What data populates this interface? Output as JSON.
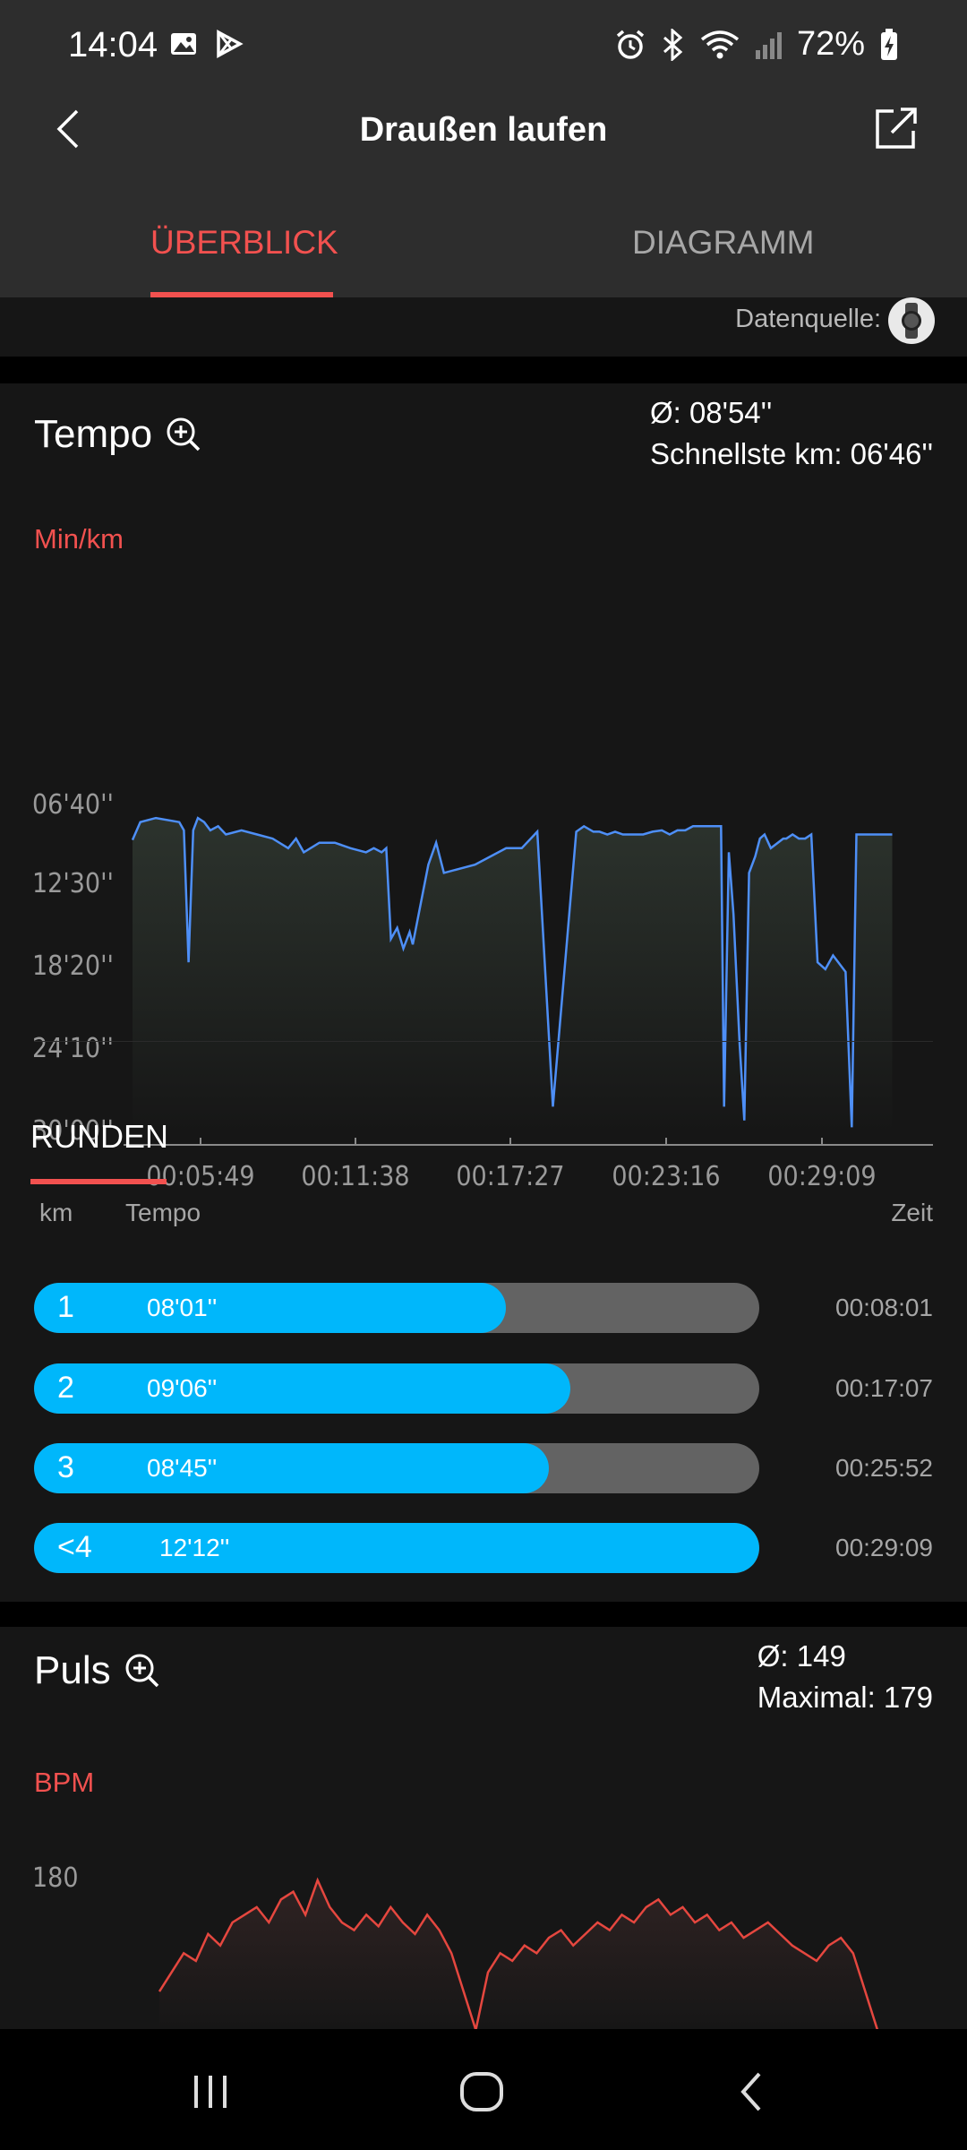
{
  "status_bar": {
    "time": "14:04",
    "battery": "72%",
    "icons": [
      "gallery-icon",
      "play-store-icon",
      "alarm-icon",
      "bluetooth-icon",
      "wifi-icon",
      "signal-icon",
      "battery-charging-icon"
    ]
  },
  "header": {
    "title": "Draußen laufen",
    "tabs": [
      {
        "label": "ÜBERBLICK",
        "active": true
      },
      {
        "label": "DIAGRAMM",
        "active": false
      }
    ]
  },
  "data_source": {
    "label": "Datenquelle:",
    "icon": "watch-icon"
  },
  "tempo": {
    "title": "Tempo",
    "avg": "Ø: 08'54''",
    "fastest": "Schnellste km: 06'46''",
    "unit": "Min/km",
    "chart_data": {
      "type": "line",
      "y_ticks": [
        "06'40''",
        "12'30''",
        "18'20''",
        "24'10''",
        "30'00''"
      ],
      "x_ticks": [
        "00:05:49",
        "00:11:38",
        "00:17:27",
        "00:23:16",
        "00:29:09"
      ],
      "x_minutes": [
        0,
        0.5,
        1.5,
        3,
        3.3,
        3.6,
        3.9,
        4.2,
        4.6,
        5,
        5.5,
        6,
        7,
        8,
        9,
        10,
        10.5,
        11,
        12,
        13,
        14,
        15,
        15.5,
        16,
        16.3,
        16.6,
        17,
        17.4,
        17.8,
        18,
        19,
        19.5,
        20,
        21,
        22,
        23,
        24,
        25,
        26,
        27,
        28.5,
        29,
        29.6,
        30,
        30.5,
        31,
        31.5,
        32,
        32.8,
        33.4,
        34,
        34.5,
        35,
        35.5,
        36,
        36.3,
        36.6,
        37,
        37.4,
        37.8,
        38,
        38.3,
        38.6,
        39,
        39.3,
        39.6,
        40,
        40.3,
        40.6,
        41,
        41.8,
        42,
        42.4,
        42.8,
        43.2,
        43.6,
        44,
        44.5,
        45,
        45.8,
        46.2,
        46.5,
        46.8,
        47.2,
        47.5,
        48,
        48.4,
        48.8
      ],
      "pace_min_per_km": [
        8.6,
        7.3,
        7.0,
        7.3,
        7.9,
        17.5,
        7.9,
        7.0,
        7.3,
        7.9,
        7.6,
        8.2,
        7.9,
        8.2,
        8.5,
        9.2,
        8.5,
        9.5,
        8.8,
        8.8,
        9.2,
        9.5,
        9.2,
        9.5,
        9.2,
        15.8,
        15.0,
        16.5,
        15.3,
        16.2,
        10.4,
        8.8,
        11.0,
        10.7,
        10.4,
        9.8,
        9.2,
        9.2,
        8.0,
        28.0,
        8.0,
        7.6,
        8.0,
        8.0,
        8.2,
        8.0,
        8.2,
        8.2,
        8.2,
        8.0,
        7.9,
        8.2,
        7.9,
        7.9,
        7.6,
        7.6,
        7.6,
        7.6,
        7.6,
        7.6,
        28.0,
        9.5,
        14.0,
        23.5,
        29.0,
        11.0,
        9.8,
        8.5,
        8.2,
        9.2,
        8.5,
        8.5,
        8.2,
        8.5,
        8.5,
        8.2,
        17.5,
        18.0,
        17.0,
        18.2,
        29.5,
        8.2,
        8.2,
        8.2,
        8.2,
        8.2,
        8.2,
        8.2
      ],
      "y_min_minutes": 6.67,
      "y_max_minutes": 30.0,
      "x_range_minutes": [
        0,
        49
      ],
      "line_color": "#4e8ff7"
    }
  },
  "runden": {
    "title": "RUNDEN",
    "col_km": "km",
    "col_tempo": "Tempo",
    "col_zeit": "Zeit",
    "laps": [
      {
        "km": "1",
        "tempo": "08'01''",
        "zeit": "00:08:01",
        "fill": 0.65
      },
      {
        "km": "2",
        "tempo": "09'06''",
        "zeit": "00:17:07",
        "fill": 0.74
      },
      {
        "km": "3",
        "tempo": "08'45''",
        "zeit": "00:25:52",
        "fill": 0.71
      },
      {
        "km": "<4",
        "tempo": "12'12''",
        "zeit": "00:29:09",
        "fill": 1.0
      }
    ],
    "bar_color": "#00b7fb"
  },
  "puls": {
    "title": "Puls",
    "avg": "Ø: 149",
    "max": "Maximal: 179",
    "unit": "BPM",
    "chart_data": {
      "type": "line",
      "y_ticks": [
        "180"
      ],
      "bpm": [
        150,
        155,
        160,
        158,
        165,
        162,
        168,
        170,
        172,
        168,
        174,
        176,
        170,
        179,
        172,
        168,
        166,
        170,
        167,
        172,
        168,
        165,
        170,
        166,
        160,
        150,
        140,
        155,
        160,
        158,
        162,
        160,
        164,
        166,
        162,
        165,
        168,
        166,
        170,
        168,
        172,
        174,
        170,
        172,
        168,
        170,
        166,
        168,
        164,
        166,
        168,
        165,
        162,
        160,
        158,
        162,
        164,
        160,
        150,
        140
      ],
      "line_color": "#e5473f"
    }
  },
  "nav": {
    "icons": [
      "recent-apps-icon",
      "home-icon",
      "back-icon"
    ]
  }
}
